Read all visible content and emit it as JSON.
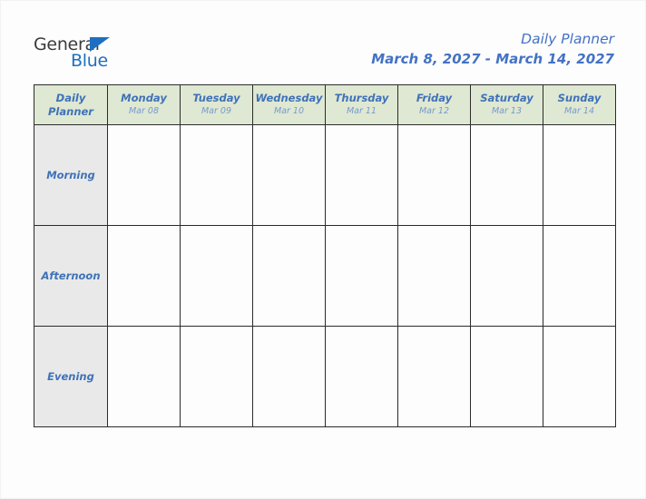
{
  "logo": {
    "word1": "General",
    "word2": "Blue",
    "triangle_icon": "triangle-icon",
    "color_dark": "#3b3b3b",
    "color_blue": "#1f6fc0"
  },
  "header": {
    "title": "Daily Planner",
    "date_range": "March 8, 2027 - March 14, 2027",
    "accent_color": "#4472c4"
  },
  "table": {
    "corner": {
      "line1": "Daily",
      "line2": "Planner"
    },
    "header_bg": "#dfe8d3",
    "row_label_bg": "#e9e9e9",
    "text_color": "#3f72b8",
    "date_text_color": "#7799cc",
    "days": [
      {
        "name": "Monday",
        "date": "Mar 08"
      },
      {
        "name": "Tuesday",
        "date": "Mar 09"
      },
      {
        "name": "Wednesday",
        "date": "Mar 10"
      },
      {
        "name": "Thursday",
        "date": "Mar 11"
      },
      {
        "name": "Friday",
        "date": "Mar 12"
      },
      {
        "name": "Saturday",
        "date": "Mar 13"
      },
      {
        "name": "Sunday",
        "date": "Mar 14"
      }
    ],
    "rows": [
      {
        "label": "Morning",
        "cells": [
          "",
          "",
          "",
          "",
          "",
          "",
          ""
        ]
      },
      {
        "label": "Afternoon",
        "cells": [
          "",
          "",
          "",
          "",
          "",
          "",
          ""
        ]
      },
      {
        "label": "Evening",
        "cells": [
          "",
          "",
          "",
          "",
          "",
          "",
          ""
        ]
      }
    ]
  }
}
